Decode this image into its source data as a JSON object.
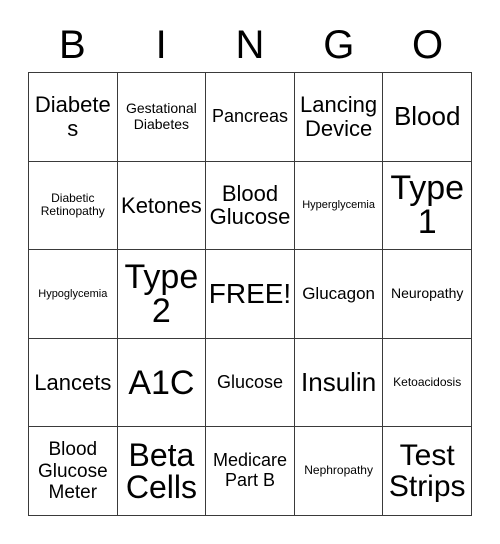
{
  "card": {
    "type": "bingo-card",
    "topic": "Diabetes",
    "columns": 5,
    "rows": 5,
    "colors": {
      "background": "#ffffff",
      "text": "#000000",
      "border": "#3a3a3a"
    }
  },
  "header": {
    "letters": [
      "B",
      "I",
      "N",
      "G",
      "O"
    ]
  },
  "grid": {
    "rows": [
      {
        "cells": [
          {
            "label": "Diabetes",
            "size": "fs-xl",
            "free": false
          },
          {
            "label": "Gestational Diabetes",
            "size": "fs-s",
            "free": false
          },
          {
            "label": "Pancreas",
            "size": "fs-ml",
            "free": false
          },
          {
            "label": "Lancing Device",
            "size": "fs-xl",
            "free": false
          },
          {
            "label": "Blood",
            "size": "fs-2xl",
            "free": false
          }
        ]
      },
      {
        "cells": [
          {
            "label": "Diabetic Retinopathy",
            "size": "fs-xs",
            "free": false
          },
          {
            "label": "Ketones",
            "size": "fs-xl",
            "free": false
          },
          {
            "label": "Blood Glucose",
            "size": "fs-xl",
            "free": false
          },
          {
            "label": "Hyperglycemia",
            "size": "fs-xxs",
            "free": false
          },
          {
            "label": "Type 1",
            "size": "fs-6xl",
            "free": false
          }
        ]
      },
      {
        "cells": [
          {
            "label": "Hypoglycemia",
            "size": "fs-xxs",
            "free": false
          },
          {
            "label": "Type 2",
            "size": "fs-6xl",
            "free": false
          },
          {
            "label": "FREE!",
            "size": "fs-3xl",
            "free": true
          },
          {
            "label": "Glucagon",
            "size": "fs-m",
            "free": false
          },
          {
            "label": "Neuropathy",
            "size": "fs-s",
            "free": false
          }
        ]
      },
      {
        "cells": [
          {
            "label": "Lancets",
            "size": "fs-xl",
            "free": false
          },
          {
            "label": "A1C",
            "size": "fs-6xl",
            "free": false
          },
          {
            "label": "Glucose",
            "size": "fs-ml",
            "free": false
          },
          {
            "label": "Insulin",
            "size": "fs-2xl",
            "free": false
          },
          {
            "label": "Ketoacidosis",
            "size": "fs-xs",
            "free": false
          }
        ]
      },
      {
        "cells": [
          {
            "label": "Blood Glucose Meter",
            "size": "fs-l",
            "free": false
          },
          {
            "label": "Beta Cells",
            "size": "fs-5xl",
            "free": false
          },
          {
            "label": "Medicare Part B",
            "size": "fs-ml",
            "free": false
          },
          {
            "label": "Nephropathy",
            "size": "fs-xs",
            "free": false
          },
          {
            "label": "Test Strips",
            "size": "fs-4xl",
            "free": false
          }
        ]
      }
    ]
  }
}
